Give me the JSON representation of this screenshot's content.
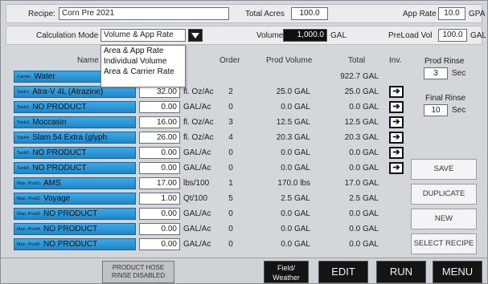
{
  "header": {
    "recipe_label": "Recipe:",
    "recipe_value": "Corn Pre 2021",
    "total_acres_label": "Total Acres",
    "total_acres_value": "100.0",
    "app_rate_label": "App Rate",
    "app_rate_value": "10.0",
    "app_rate_unit": "GPA",
    "calc_mode_label": "Calculation Mode",
    "calc_mode_value": "Volume & App Rate",
    "volume_label": "Volume",
    "volume_value": "1,000.0",
    "volume_unit": "GAL",
    "preload_label": "PreLoad Vol",
    "preload_value": "100.0",
    "preload_unit": "GAL"
  },
  "dropdown": {
    "options": [
      "Area & App Rate",
      "Individual Volume",
      "Area & Carrier Rate"
    ]
  },
  "columns": {
    "name": "Name",
    "order": "Order",
    "prod_volume": "Prod Volume",
    "total": "Total",
    "inv": "Inv."
  },
  "carrier": {
    "prefix": "Carrier:",
    "name": "Water",
    "total": "922.7 GAL"
  },
  "products": [
    {
      "prefix": "Tank1:",
      "name": "Atra-V 4L (Atrazine)",
      "rate": "32.00",
      "unit": "fl. Oz/Ac",
      "order": "2",
      "prod_volume": "25.0 GAL",
      "total": "25.0 GAL",
      "inv": "➔"
    },
    {
      "prefix": "Tank2:",
      "name": "NO PRODUCT",
      "rate": "0.00",
      "unit": "GAL/Ac",
      "order": "0",
      "prod_volume": "0.0 GAL",
      "total": "0.0 GAL",
      "inv": "➔"
    },
    {
      "prefix": "Tank3:",
      "name": "Moccasin",
      "rate": "16.00",
      "unit": "fl. Oz/Ac",
      "order": "3",
      "prod_volume": "12.5 GAL",
      "total": "12.5 GAL",
      "inv": "➔"
    },
    {
      "prefix": "Tank4:",
      "name": "Slam 54 Extra (glyph",
      "rate": "26.00",
      "unit": "fl. Oz/Ac",
      "order": "4",
      "prod_volume": "20.3 GAL",
      "total": "20.3 GAL",
      "inv": "➔"
    },
    {
      "prefix": "Tank5:",
      "name": "NO PRODUCT",
      "rate": "0.00",
      "unit": "GAL/Ac",
      "order": "0",
      "prod_volume": "0.0 GAL",
      "total": "0.0 GAL",
      "inv": "➔"
    },
    {
      "prefix": "Tank6:",
      "name": "NO PRODUCT",
      "rate": "0.00",
      "unit": "GAL/Ac",
      "order": "0",
      "prod_volume": "0.0 GAL",
      "total": "0.0 GAL",
      "inv": "➔"
    },
    {
      "prefix": "Man. Prod1:",
      "name": "AMS",
      "rate": "17.00",
      "unit": "lbs/100",
      "order": "1",
      "prod_volume": "170.0 lbs",
      "total": "17.0 GAL",
      "inv": ""
    },
    {
      "prefix": "Man. Prod2:",
      "name": "Voyage",
      "rate": "1.00",
      "unit": "Qt/100",
      "order": "5",
      "prod_volume": "2.5 GAL",
      "total": "2.5 GAL",
      "inv": ""
    },
    {
      "prefix": "Man. Prod3:",
      "name": "NO PRODUCT",
      "rate": "0.00",
      "unit": "GAL/Ac",
      "order": "0",
      "prod_volume": "0.0 GAL",
      "total": "0.0 GAL",
      "inv": ""
    },
    {
      "prefix": "Man. Prod4:",
      "name": "NO PRODUCT",
      "rate": "0.00",
      "unit": "GAL/Ac",
      "order": "0",
      "prod_volume": "0.0 GAL",
      "total": "0.0 GAL",
      "inv": ""
    },
    {
      "prefix": "Man. Prod5:",
      "name": "NO PRODUCT",
      "rate": "0.00",
      "unit": "GAL/Ac",
      "order": "0",
      "prod_volume": "0.0 GAL",
      "total": "0.0 GAL",
      "inv": ""
    }
  ],
  "rinse": {
    "prod_label": "Prod Rinse",
    "prod_value": "3",
    "prod_unit": "Sec",
    "final_label": "Final Rinse",
    "final_value": "10",
    "final_unit": "Sec"
  },
  "side_buttons": {
    "save": "SAVE",
    "duplicate": "DUPLICATE",
    "new": "NEW",
    "select_recipe": "SELECT RECIPE"
  },
  "bottom": {
    "hose_line1": "PRODUCT HOSE",
    "hose_line2": "RINSE DISABLED",
    "field_line1": "Field/",
    "field_line2": "Weather",
    "edit": "EDIT",
    "run": "RUN",
    "menu": "MENU"
  },
  "colors": {
    "product_button": "#2b97d8",
    "screen_bg": "#d3d6db",
    "dark_button": "#141414"
  },
  "icons": {
    "dropdown_arrow": "chevron-down-icon",
    "inventory": "arrow-right-icon"
  }
}
